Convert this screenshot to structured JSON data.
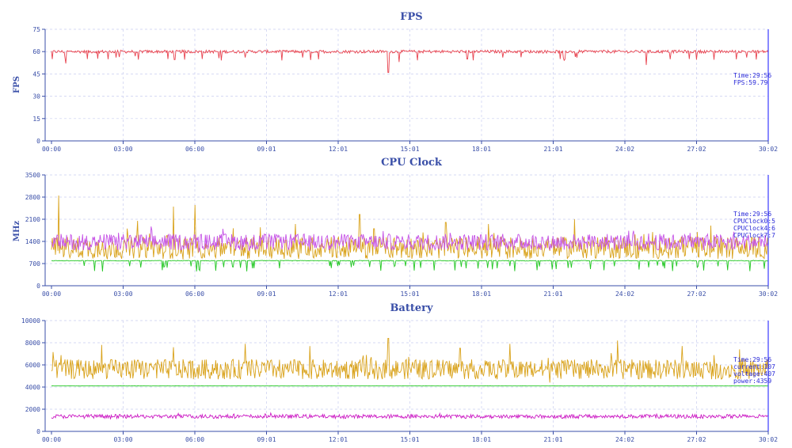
{
  "chart_data": [
    {
      "type": "line",
      "title": "FPS",
      "ylabel": "FPS",
      "ylim": [
        0,
        75
      ],
      "yticks": [
        "75",
        "60",
        "45",
        "30",
        "15",
        "0"
      ],
      "xticks": [
        "00:00",
        "03:00",
        "06:00",
        "09:01",
        "12:01",
        "15:01",
        "18:01",
        "21:01",
        "24:02",
        "27:02",
        "30:02"
      ],
      "grid": true,
      "series": [
        {
          "color": "#e8434f",
          "base": 60,
          "noise": 1.0,
          "spikes": [
            {
              "t": 0.02,
              "v": 52
            },
            {
              "t": 0.05,
              "v": 55
            },
            {
              "t": 0.09,
              "v": 56
            },
            {
              "t": 0.21,
              "v": 55
            },
            {
              "t": 0.27,
              "v": 56
            },
            {
              "t": 0.35,
              "v": 56
            },
            {
              "t": 0.47,
              "v": 46
            },
            {
              "t": 0.485,
              "v": 53
            },
            {
              "t": 0.58,
              "v": 55
            },
            {
              "t": 0.63,
              "v": 56
            },
            {
              "t": 0.71,
              "v": 55
            },
            {
              "t": 0.83,
              "v": 51
            },
            {
              "t": 0.89,
              "v": 55
            },
            {
              "t": 0.97,
              "v": 56
            }
          ]
        }
      ],
      "readout": [
        "Time:29:56",
        "FPS:59.79"
      ]
    },
    {
      "type": "line",
      "title": "CPU Clock",
      "ylabel": "MHz",
      "ylim": [
        0,
        3500
      ],
      "yticks": [
        "3500",
        "2800",
        "2100",
        "1400",
        "700",
        "0"
      ],
      "xticks": [
        "00:00",
        "03:00",
        "06:00",
        "09:01",
        "12:01",
        "15:01",
        "18:01",
        "21:01",
        "24:02",
        "27:02",
        "30:02"
      ],
      "grid": true,
      "series": [
        {
          "color": "#22c722",
          "base": 790,
          "noise": 10,
          "dips": true,
          "dipValue": 450
        },
        {
          "color": "#d9a21a",
          "base": 1200,
          "noise": 350,
          "spikes": [
            {
              "t": 0.01,
              "v": 2850
            },
            {
              "t": 0.12,
              "v": 2050
            },
            {
              "t": 0.17,
              "v": 2500
            },
            {
              "t": 0.2,
              "v": 2550
            },
            {
              "t": 0.34,
              "v": 1950
            },
            {
              "t": 0.43,
              "v": 2250
            },
            {
              "t": 0.45,
              "v": 1800
            },
            {
              "t": 0.55,
              "v": 2000
            },
            {
              "t": 0.61,
              "v": 1950
            },
            {
              "t": 0.73,
              "v": 2100
            },
            {
              "t": 0.92,
              "v": 1900
            }
          ]
        },
        {
          "color": "#c653e6",
          "base": 1380,
          "noise": 260,
          "spikes": []
        }
      ],
      "readout": [
        "Time:29:56",
        "CPUClock0:5",
        "CPUClock4:6",
        "CPUClock7:7"
      ]
    },
    {
      "type": "line",
      "title": "Battery",
      "ylabel": "",
      "ylim": [
        0,
        10000
      ],
      "yticks": [
        "10000",
        "8000",
        "6000",
        "4000",
        "2000",
        "0"
      ],
      "xticks": [
        "00:00",
        "03:00",
        "06:00",
        "09:01",
        "12:01",
        "15:01",
        "18:01",
        "21:01",
        "24:02",
        "27:02",
        "30:02"
      ],
      "grid": true,
      "series": [
        {
          "color": "#d9a21a",
          "base": 5600,
          "noise": 900,
          "spikes": [
            {
              "t": 0.07,
              "v": 7800
            },
            {
              "t": 0.17,
              "v": 7600
            },
            {
              "t": 0.27,
              "v": 7900
            },
            {
              "t": 0.36,
              "v": 7700
            },
            {
              "t": 0.47,
              "v": 8400
            },
            {
              "t": 0.57,
              "v": 7500
            },
            {
              "t": 0.64,
              "v": 7900
            },
            {
              "t": 0.79,
              "v": 8200
            },
            {
              "t": 0.88,
              "v": 7700
            },
            {
              "t": 0.96,
              "v": 7400
            }
          ]
        },
        {
          "color": "#22c722",
          "base": 4100,
          "noise": 5,
          "spikes": []
        },
        {
          "color": "#cc1cc4",
          "base": 1350,
          "noise": 180,
          "spikes": []
        }
      ],
      "readout": [
        "Time:29:56",
        "current:107",
        "voltage:407",
        "power:4359"
      ]
    }
  ]
}
